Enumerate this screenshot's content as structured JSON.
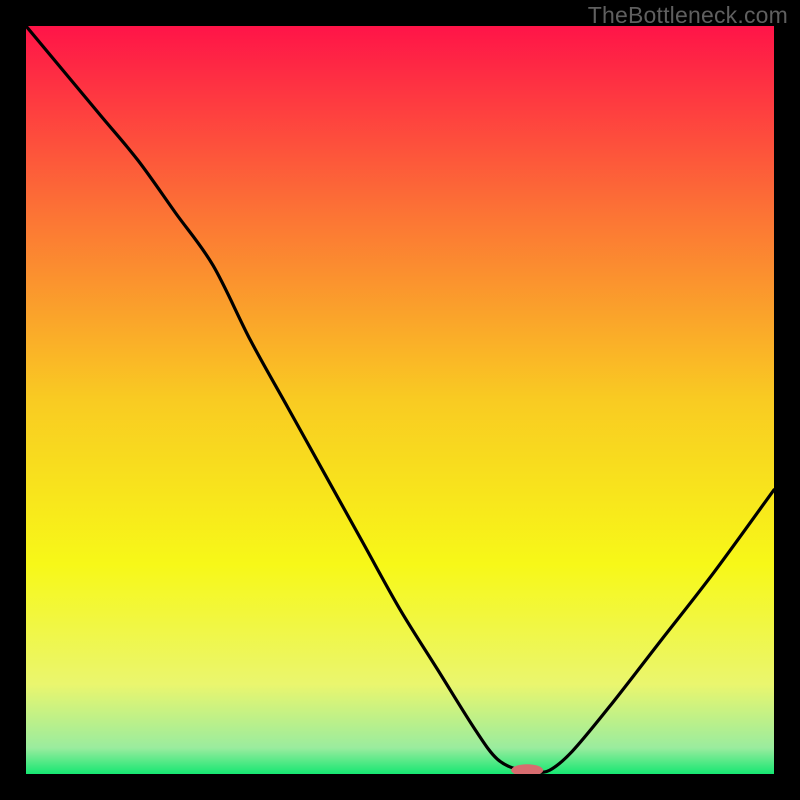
{
  "watermark": "TheBottleneck.com",
  "chart_data": {
    "type": "line",
    "title": "",
    "xlabel": "",
    "ylabel": "",
    "xlim": [
      0,
      100
    ],
    "ylim": [
      0,
      100
    ],
    "legend": false,
    "grid": false,
    "background_gradient": {
      "stops": [
        {
          "pos": 0.0,
          "color": "#FF1448"
        },
        {
          "pos": 0.25,
          "color": "#FC7335"
        },
        {
          "pos": 0.5,
          "color": "#F9CB22"
        },
        {
          "pos": 0.72,
          "color": "#F7F818"
        },
        {
          "pos": 0.88,
          "color": "#EAF66E"
        },
        {
          "pos": 0.965,
          "color": "#9AEC9E"
        },
        {
          "pos": 1.0,
          "color": "#16E772"
        }
      ]
    },
    "series": [
      {
        "name": "bottleneck-curve",
        "x": [
          0,
          5,
          10,
          15,
          20,
          25,
          30,
          35,
          40,
          45,
          50,
          55,
          60,
          63,
          66,
          68,
          70,
          73,
          78,
          85,
          92,
          100
        ],
        "y": [
          100,
          94,
          88,
          82,
          75,
          68,
          58,
          49,
          40,
          31,
          22,
          14,
          6,
          2,
          0.5,
          0.3,
          0.5,
          3,
          9,
          18,
          27,
          38
        ]
      }
    ],
    "marker": {
      "name": "optimal-point",
      "x": 67,
      "y": 0.5,
      "color": "#D86C6F",
      "rx": 16,
      "ry": 6
    }
  }
}
